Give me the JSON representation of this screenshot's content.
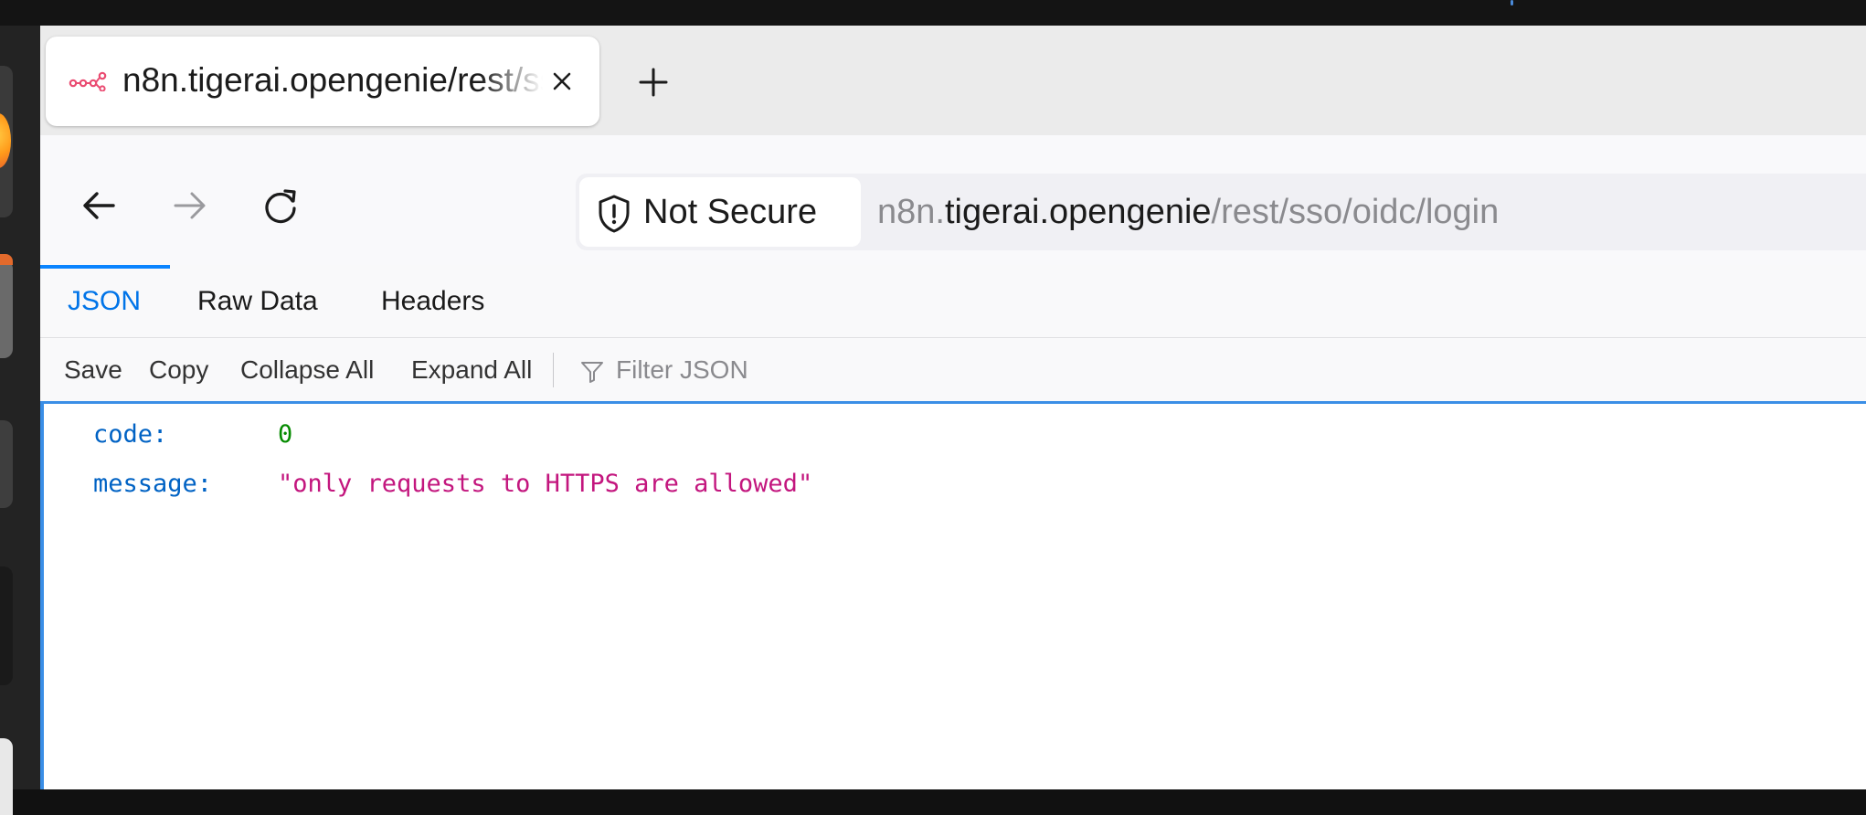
{
  "tab": {
    "title": "n8n.tigerai.opengenie/rest/sso/oidc/login",
    "favicon_icon": "n8n-logo-icon",
    "close_icon": "close-icon"
  },
  "new_tab_icon": "plus-icon",
  "nav": {
    "back_icon": "arrow-left-icon",
    "forward_icon": "arrow-right-icon",
    "reload_icon": "reload-icon"
  },
  "urlbar": {
    "security_label": "Not Secure",
    "security_icon": "shield-warning-icon",
    "url_prefix": "n8n.",
    "url_host": "tigerai.opengenie",
    "url_path": "/rest/sso/oidc/login"
  },
  "viewer_tabs": [
    {
      "label": "JSON",
      "active": true
    },
    {
      "label": "Raw Data",
      "active": false
    },
    {
      "label": "Headers",
      "active": false
    }
  ],
  "toolbar": {
    "save": "Save",
    "copy": "Copy",
    "collapse_all": "Collapse All",
    "expand_all": "Expand All",
    "filter_placeholder": "Filter JSON",
    "filter_icon": "filter-icon"
  },
  "json": {
    "rows": [
      {
        "key": "code:",
        "value": "0",
        "type": "number"
      },
      {
        "key": "message:",
        "value": "\"only requests to HTTPS are allowed\"",
        "type": "string"
      }
    ]
  },
  "colors": {
    "accent": "#0a84ff",
    "json_key": "#0062c4",
    "json_number": "#058b00",
    "json_string": "#c3167e"
  }
}
